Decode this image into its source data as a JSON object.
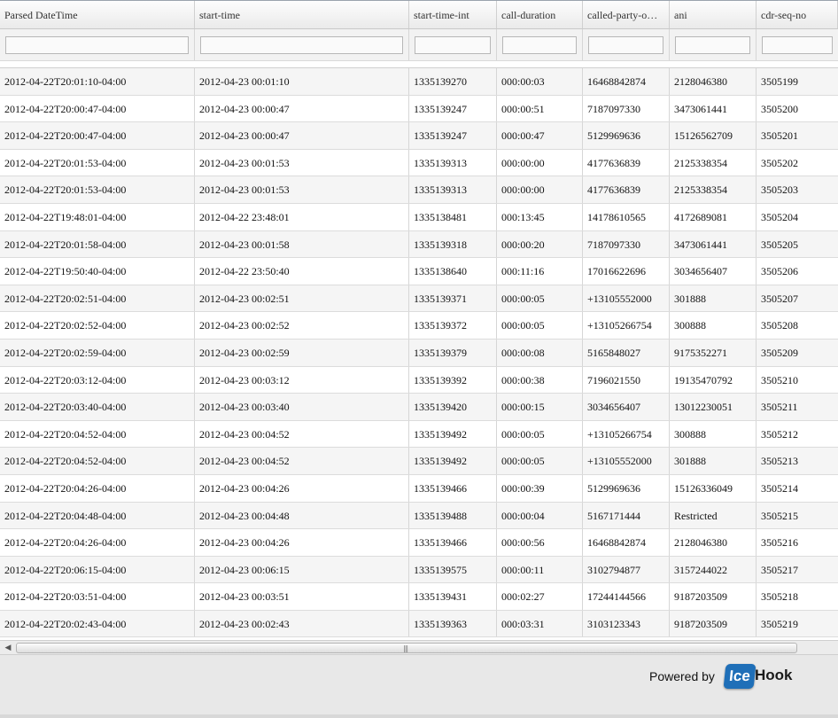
{
  "columns": [
    "Parsed DateTime",
    "start-time",
    "start-time-int",
    "call-duration",
    "called-party-o…",
    "ani",
    "cdr-seq-no"
  ],
  "rows": [
    [
      "2012-04-22T20:01:10-04:00",
      "2012-04-23 00:01:10",
      "1335139270",
      "000:00:03",
      "16468842874",
      "2128046380",
      "3505199"
    ],
    [
      "2012-04-22T20:00:47-04:00",
      "2012-04-23 00:00:47",
      "1335139247",
      "000:00:51",
      "7187097330",
      "3473061441",
      "3505200"
    ],
    [
      "2012-04-22T20:00:47-04:00",
      "2012-04-23 00:00:47",
      "1335139247",
      "000:00:47",
      "5129969636",
      "15126562709",
      "3505201"
    ],
    [
      "2012-04-22T20:01:53-04:00",
      "2012-04-23 00:01:53",
      "1335139313",
      "000:00:00",
      "4177636839",
      "2125338354",
      "3505202"
    ],
    [
      "2012-04-22T20:01:53-04:00",
      "2012-04-23 00:01:53",
      "1335139313",
      "000:00:00",
      "4177636839",
      "2125338354",
      "3505203"
    ],
    [
      "2012-04-22T19:48:01-04:00",
      "2012-04-22 23:48:01",
      "1335138481",
      "000:13:45",
      "14178610565",
      "4172689081",
      "3505204"
    ],
    [
      "2012-04-22T20:01:58-04:00",
      "2012-04-23 00:01:58",
      "1335139318",
      "000:00:20",
      "7187097330",
      "3473061441",
      "3505205"
    ],
    [
      "2012-04-22T19:50:40-04:00",
      "2012-04-22 23:50:40",
      "1335138640",
      "000:11:16",
      "17016622696",
      "3034656407",
      "3505206"
    ],
    [
      "2012-04-22T20:02:51-04:00",
      "2012-04-23 00:02:51",
      "1335139371",
      "000:00:05",
      "+13105552000",
      "301888",
      "3505207"
    ],
    [
      "2012-04-22T20:02:52-04:00",
      "2012-04-23 00:02:52",
      "1335139372",
      "000:00:05",
      "+13105266754",
      "300888",
      "3505208"
    ],
    [
      "2012-04-22T20:02:59-04:00",
      "2012-04-23 00:02:59",
      "1335139379",
      "000:00:08",
      "5165848027",
      "9175352271",
      "3505209"
    ],
    [
      "2012-04-22T20:03:12-04:00",
      "2012-04-23 00:03:12",
      "1335139392",
      "000:00:38",
      "7196021550",
      "19135470792",
      "3505210"
    ],
    [
      "2012-04-22T20:03:40-04:00",
      "2012-04-23 00:03:40",
      "1335139420",
      "000:00:15",
      "3034656407",
      "13012230051",
      "3505211"
    ],
    [
      "2012-04-22T20:04:52-04:00",
      "2012-04-23 00:04:52",
      "1335139492",
      "000:00:05",
      "+13105266754",
      "300888",
      "3505212"
    ],
    [
      "2012-04-22T20:04:52-04:00",
      "2012-04-23 00:04:52",
      "1335139492",
      "000:00:05",
      "+13105552000",
      "301888",
      "3505213"
    ],
    [
      "2012-04-22T20:04:26-04:00",
      "2012-04-23 00:04:26",
      "1335139466",
      "000:00:39",
      "5129969636",
      "15126336049",
      "3505214"
    ],
    [
      "2012-04-22T20:04:48-04:00",
      "2012-04-23 00:04:48",
      "1335139488",
      "000:00:04",
      "5167171444",
      "Restricted",
      "3505215"
    ],
    [
      "2012-04-22T20:04:26-04:00",
      "2012-04-23 00:04:26",
      "1335139466",
      "000:00:56",
      "16468842874",
      "2128046380",
      "3505216"
    ],
    [
      "2012-04-22T20:06:15-04:00",
      "2012-04-23 00:06:15",
      "1335139575",
      "000:00:11",
      "3102794877",
      "3157244022",
      "3505217"
    ],
    [
      "2012-04-22T20:03:51-04:00",
      "2012-04-23 00:03:51",
      "1335139431",
      "000:02:27",
      "17244144566",
      "9187203509",
      "3505218"
    ],
    [
      "2012-04-22T20:02:43-04:00",
      "2012-04-23 00:02:43",
      "1335139363",
      "000:03:31",
      "3103123343",
      "9187203509",
      "3505219"
    ]
  ],
  "footer": {
    "powered_by": "Powered by",
    "logo_ice": "Ice",
    "logo_hook": "Hook"
  },
  "scrollbar": {
    "left_icon": "arrow-left-icon",
    "grip_icon": "grip-icon"
  },
  "colors": {
    "logo_blue": "#1f6fb8",
    "footer_bg": "#e8e8e8",
    "row_alt": "#f5f5f5"
  }
}
